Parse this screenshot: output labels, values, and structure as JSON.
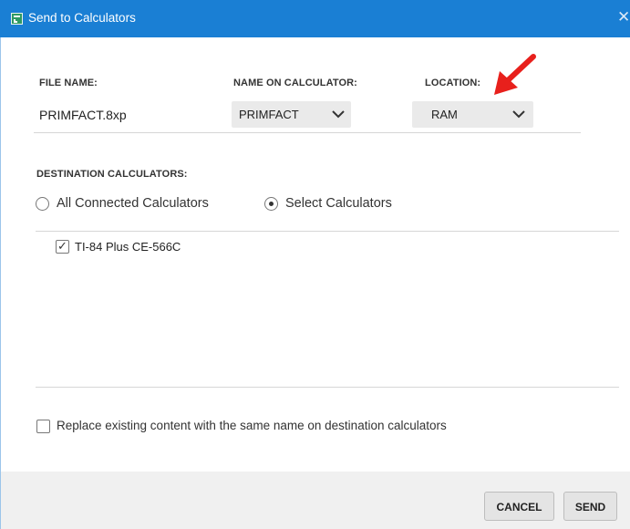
{
  "window": {
    "title": "Send to Calculators",
    "close_glyph": "✕",
    "accent_color": "#1a7fd4"
  },
  "file_section": {
    "file_name_label": "FILE NAME:",
    "name_on_calc_label": "NAME ON CALCULATOR:",
    "location_label": "LOCATION:",
    "file_name": "PRIMFACT.8xp",
    "name_on_calc_value": "PRIMFACT",
    "location_value": "RAM"
  },
  "destination": {
    "label": "DESTINATION CALCULATORS:",
    "option_all": "All Connected Calculators",
    "option_select": "Select Calculators",
    "selected_option": "Select Calculators",
    "calculators": [
      {
        "name": "TI-84 Plus CE-566C",
        "checked": true
      }
    ]
  },
  "replace_option": {
    "label": "Replace existing content with the same name on destination calculators",
    "checked": false
  },
  "buttons": {
    "cancel": "CANCEL",
    "send": "SEND"
  },
  "annotation": {
    "arrow_color": "#e8201c",
    "arrow_target": "location-dropdown"
  }
}
